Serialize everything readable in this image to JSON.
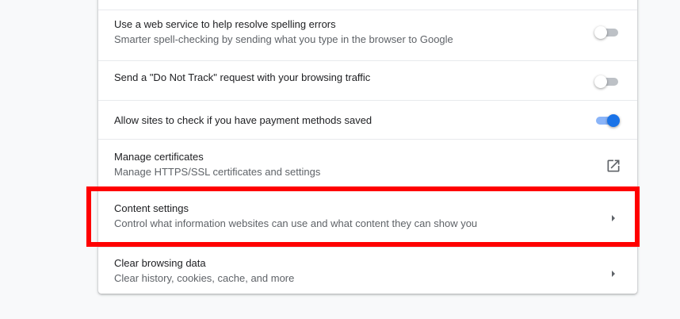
{
  "settings": {
    "spelling": {
      "title": "Use a web service to help resolve spelling errors",
      "subtitle": "Smarter spell-checking by sending what you type in the browser to Google",
      "enabled": false
    },
    "do_not_track": {
      "title": "Send a \"Do Not Track\" request with your browsing traffic",
      "enabled": false
    },
    "payment_methods": {
      "title": "Allow sites to check if you have payment methods saved",
      "enabled": true
    },
    "certificates": {
      "title": "Manage certificates",
      "subtitle": "Manage HTTPS/SSL certificates and settings",
      "icon": "open-in-new-icon"
    },
    "content_settings": {
      "title": "Content settings",
      "subtitle": "Control what information websites can use and what content they can show you",
      "icon": "chevron-right-icon",
      "highlighted": true
    },
    "clear_browsing": {
      "title": "Clear browsing data",
      "subtitle": "Clear history, cookies, cache, and more",
      "icon": "chevron-right-icon"
    }
  },
  "colors": {
    "toggle_on": "#1a73e8",
    "toggle_off": "#bdc1c6",
    "highlight": "#ff0000"
  }
}
